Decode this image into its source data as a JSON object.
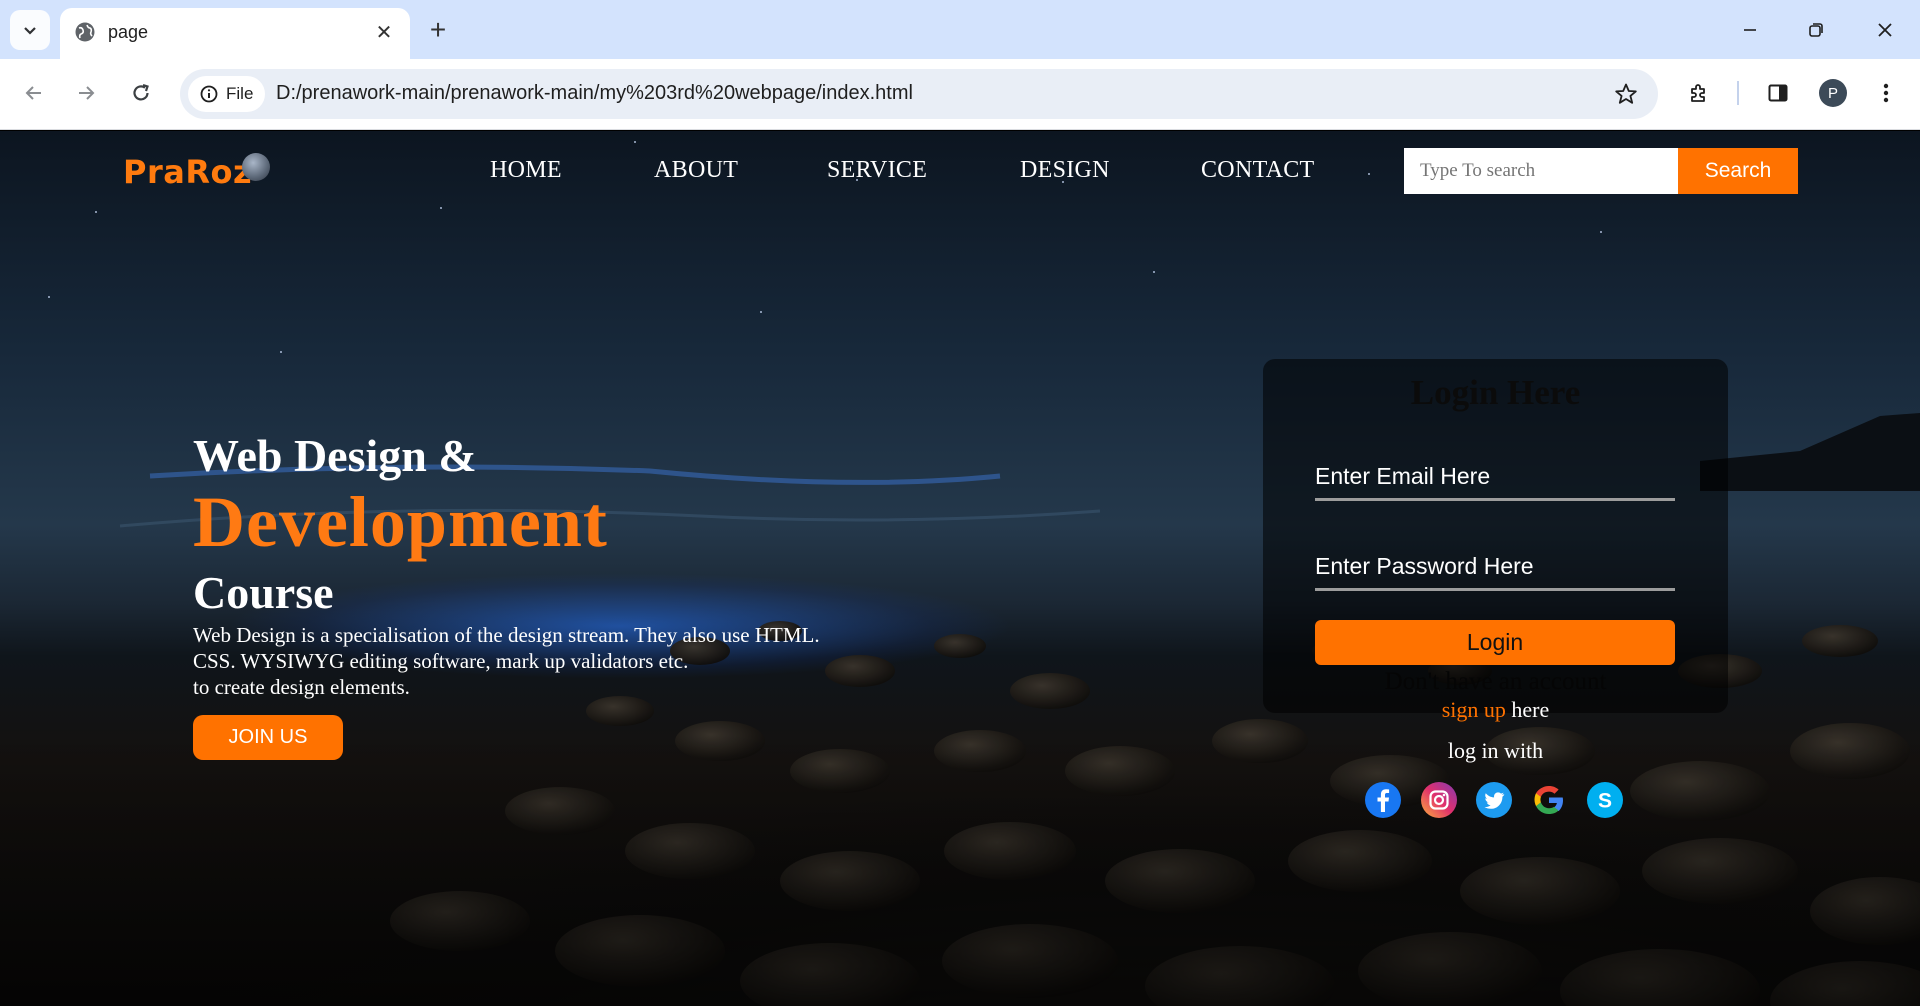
{
  "browser": {
    "tab_title": "page",
    "url_chip": "File",
    "url": "D:/prenawork-main/prenawork-main/my%203rd%20webpage/index.html",
    "profile_initial": "P"
  },
  "site": {
    "logo": "PraRoz",
    "nav": [
      "HOME",
      "ABOUT",
      "SERVICE",
      "DESIGN",
      "CONTACT"
    ],
    "search_placeholder": "Type To search",
    "search_button": "Search"
  },
  "hero": {
    "line1": "Web Design &",
    "line2": "Development",
    "line3": "Course",
    "description": [
      "Web Design is a specialisation of the design stream. They also use HTML.",
      "CSS. WYSIWYG editing software, mark up validators etc.",
      "to create design elements."
    ],
    "cta": "JOIN US"
  },
  "login": {
    "title": "Login Here",
    "email_placeholder": "Enter Email Here",
    "password_placeholder": "Enter Password Here",
    "button": "Login",
    "no_account": "Don't have an account",
    "signup_link": "sign up",
    "signup_suffix": "here",
    "login_with": "log in with",
    "social": [
      "facebook",
      "instagram",
      "twitter",
      "google",
      "skype"
    ]
  },
  "colors": {
    "accent": "#ff7200",
    "chrome_tabstrip": "#d3e3fd"
  }
}
